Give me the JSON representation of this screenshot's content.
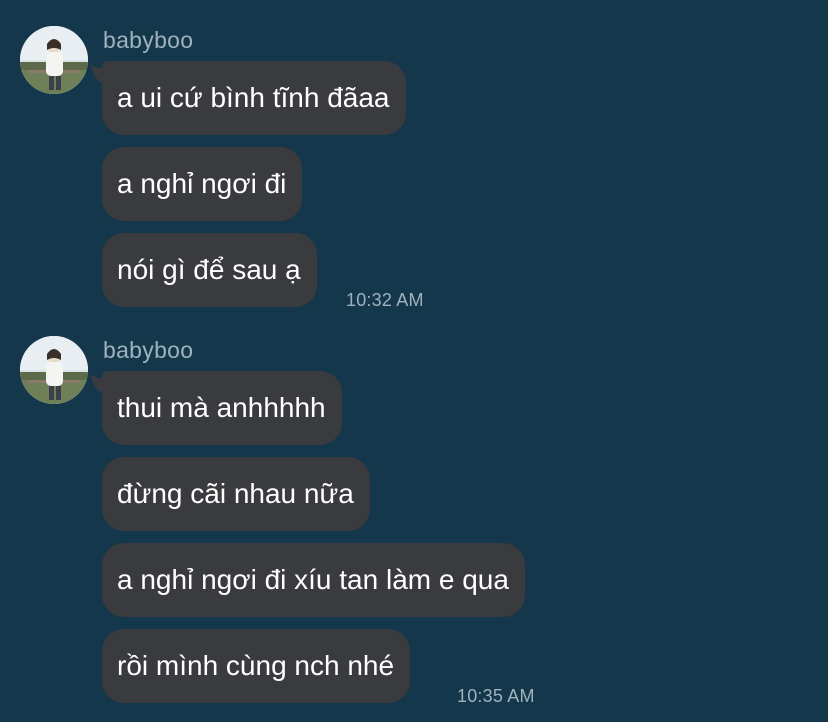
{
  "conversation": {
    "groups": [
      {
        "sender": "babyboo",
        "messages": [
          "a ui cứ bình tĩnh đãaa",
          "a nghỉ ngơi đi",
          "nói gì để sau ạ"
        ],
        "time": "10:32 AM"
      },
      {
        "sender": "babyboo",
        "messages": [
          "thui mà anhhhhh",
          "đừng cãi nhau nữa",
          "a nghỉ ngơi đi xíu tan làm e qua",
          "rồi mình cùng nch nhé"
        ],
        "time": "10:35 AM"
      }
    ]
  },
  "colors": {
    "background": "#14374b",
    "bubble": "#3a3b3e",
    "bubble_text": "#ffffff",
    "meta_text": "#9fb2bd"
  },
  "icons": {
    "avatar": "profile-photo"
  }
}
